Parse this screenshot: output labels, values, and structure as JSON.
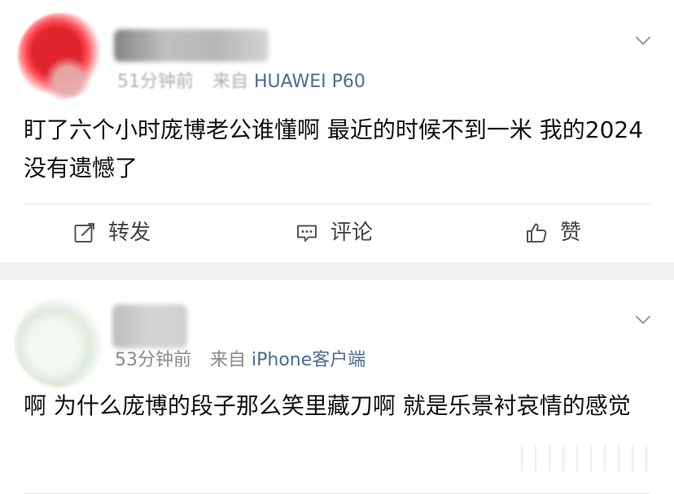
{
  "posts": [
    {
      "time": "51分钟前",
      "source_prefix": "来自",
      "source": "HUAWEI P60",
      "text": "盯了六个小时庞博老公谁懂啊 最近的时候不到一米 我的2024没有遗憾了",
      "actions": {
        "repost": "转发",
        "comment": "评论",
        "like": "赞"
      }
    },
    {
      "time": "53分钟前",
      "source_prefix": "来自",
      "source": "iPhone客户端",
      "text": "啊 为什么庞博的段子那么笑里藏刀啊 就是乐景衬哀情的感觉"
    }
  ],
  "colors": {
    "source_link": "#4d6b91",
    "meta_gray": "#8a8a8a",
    "separator": "#f1f1f1",
    "action_gray": "#444444"
  },
  "icons": {
    "repost": "edit-square-icon",
    "comment": "comment-icon",
    "like": "thumbs-up-icon",
    "more": "chevron-down-icon"
  }
}
